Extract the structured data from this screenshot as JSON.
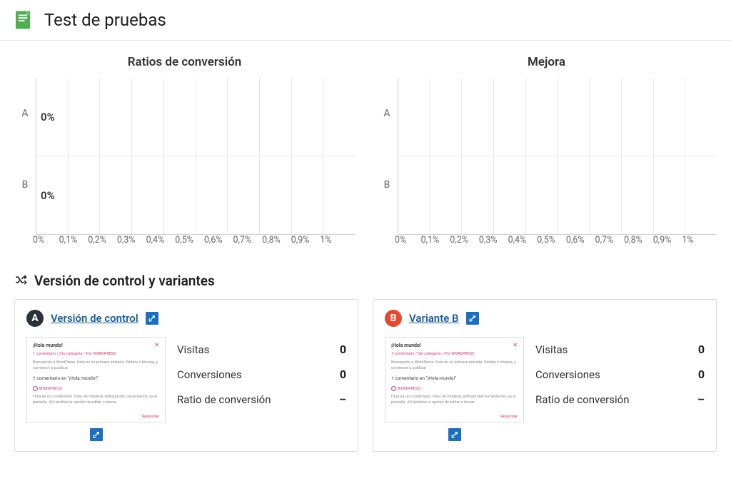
{
  "header": {
    "title": "Test de pruebas"
  },
  "chart_data": [
    {
      "type": "bar",
      "orientation": "horizontal",
      "title": "Ratios de conversión",
      "categories": [
        "A",
        "B"
      ],
      "values": [
        0,
        0
      ],
      "value_labels": [
        "0%",
        "0%"
      ],
      "xlim": [
        0,
        1
      ],
      "x_ticks": [
        "0%",
        "0,1%",
        "0,2%",
        "0,3%",
        "0,4%",
        "0,5%",
        "0,6%",
        "0,7%",
        "0,8%",
        "0,9%",
        "1%"
      ]
    },
    {
      "type": "bar",
      "orientation": "horizontal",
      "title": "Mejora",
      "categories": [
        "A",
        "B"
      ],
      "values": [
        null,
        null
      ],
      "value_labels": [
        "",
        ""
      ],
      "xlim": [
        0,
        1
      ],
      "x_ticks": [
        "0%",
        "0,1%",
        "0,2%",
        "0,3%",
        "0,4%",
        "0,5%",
        "0,6%",
        "0,7%",
        "0,8%",
        "0,9%",
        "1%"
      ]
    }
  ],
  "section": {
    "title": "Versión de control y variantes"
  },
  "variants": [
    {
      "badge_letter": "A",
      "badge_class": "badge-a",
      "title": "Versión de control",
      "stats": [
        {
          "label": "Visitas",
          "value": "0"
        },
        {
          "label": "Conversiones",
          "value": "0"
        },
        {
          "label": "Ratio de conversión",
          "value": "–"
        }
      ],
      "thumb": {
        "title": "¡Hola mundo!",
        "meta": "1 comentario / Sin categoría / Por WORDPRESS",
        "text": "Bienvenido a WordPress. Esta es su primera entrada. Edítela o bórrala, y comience a publicar",
        "comment": "1 comentario en \"¡Hola mundo!\""
      }
    },
    {
      "badge_letter": "B",
      "badge_class": "badge-b",
      "title": "Variante B",
      "stats": [
        {
          "label": "Visitas",
          "value": "0"
        },
        {
          "label": "Conversiones",
          "value": "0"
        },
        {
          "label": "Ratio de conversión",
          "value": "–"
        }
      ],
      "thumb": {
        "title": "¡Hola mundo!",
        "meta": "1 comentario / Sin categoría / Por WORDPRESS",
        "text": "Bienvenido a WordPress. Esta es su primera entrada. Edítela o bórrala, y comience a publicar",
        "comment": "1 comentario en \"¡Hola mundo!\""
      }
    }
  ]
}
